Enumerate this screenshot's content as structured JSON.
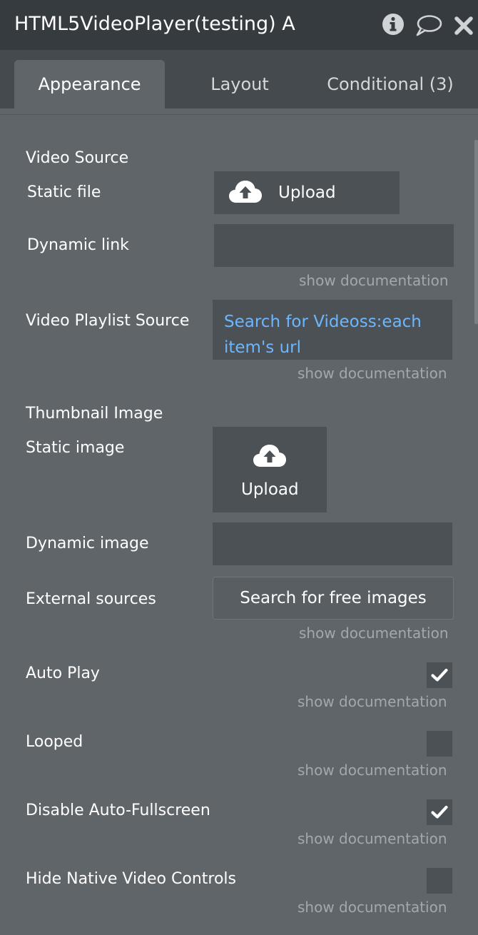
{
  "header": {
    "title": "HTML5VideoPlayer(testing) A",
    "icons": [
      "info-icon",
      "comment-icon",
      "close-icon"
    ]
  },
  "tabs": [
    {
      "label": "Appearance",
      "active": true
    },
    {
      "label": "Layout",
      "active": false
    },
    {
      "label": "Conditional (3)",
      "active": false
    }
  ],
  "video_source": {
    "heading": "Video Source",
    "static_file_label": "Static file",
    "upload_label": "Upload",
    "dynamic_link_label": "Dynamic link",
    "dynamic_link_value": "",
    "doc": "show documentation"
  },
  "playlist": {
    "label": "Video Playlist Source",
    "value": "Search for Videoss:each item's url",
    "doc": "show documentation"
  },
  "thumbnail": {
    "heading": "Thumbnail Image",
    "static_image_label": "Static image",
    "upload_label": "Upload",
    "dynamic_image_label": "Dynamic image",
    "dynamic_image_value": "",
    "external_label": "External sources",
    "external_button": "Search for free images",
    "doc": "show documentation"
  },
  "options": [
    {
      "label": "Auto Play",
      "checked": true,
      "doc": "show documentation"
    },
    {
      "label": "Looped",
      "checked": false,
      "doc": "show documentation"
    },
    {
      "label": "Disable Auto-Fullscreen",
      "checked": true,
      "doc": "show documentation"
    },
    {
      "label": "Hide Native Video Controls",
      "checked": false,
      "doc": "show documentation"
    }
  ],
  "colors": {
    "panel_bg": "#60656a",
    "header_bg": "#363b40",
    "tabbar_bg": "#454a4f",
    "field_bg": "#4c5156",
    "link_text": "#6cb6ff",
    "doc_text": "#a3a8ad"
  }
}
